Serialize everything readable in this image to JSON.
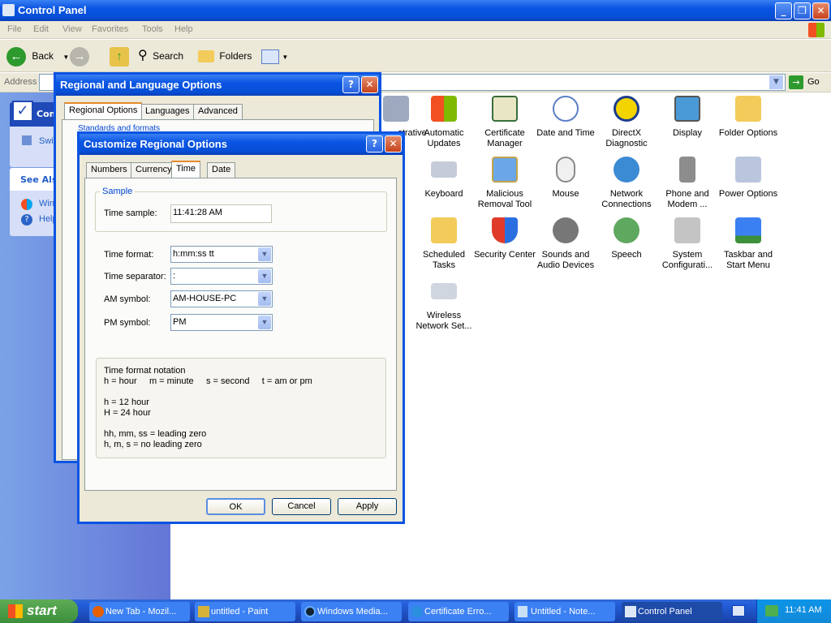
{
  "window": {
    "title": "Control Panel"
  },
  "menu": [
    "File",
    "Edit",
    "View",
    "Favorites",
    "Tools",
    "Help"
  ],
  "toolbar": {
    "back": "Back",
    "search": "Search",
    "folders": "Folders"
  },
  "address": {
    "label": "Address",
    "go": "Go"
  },
  "leftpane": {
    "panel_title": "Con",
    "switch": "Swi",
    "see_also": "See Als",
    "win": "Win",
    "help": "Help"
  },
  "icons": [
    {
      "name": "Administrative Tools",
      "label": "..strative"
    },
    {
      "name": "Automatic Updates",
      "label": "Automatic Updates"
    },
    {
      "name": "Certificate Manager",
      "label": "Certificate Manager"
    },
    {
      "name": "Date and Time",
      "label": "Date and Time"
    },
    {
      "name": "DirectX Diagnostic",
      "label": "DirectX Diagnostic"
    },
    {
      "name": "Display",
      "label": "Display"
    },
    {
      "name": "Folder Options",
      "label": "Folder Options"
    },
    {
      "name": "Keyboard",
      "label": "Keyboard"
    },
    {
      "name": "Malicious Removal Tool",
      "label": "Malicious Removal Tool"
    },
    {
      "name": "Mouse",
      "label": "Mouse"
    },
    {
      "name": "Network Connections",
      "label": "Network Connections"
    },
    {
      "name": "Phone and Modem",
      "label": "Phone and Modem ..."
    },
    {
      "name": "Power Options",
      "label": "Power Options"
    },
    {
      "name": "Scheduled Tasks",
      "label": "Scheduled Tasks"
    },
    {
      "name": "Security Center",
      "label": "Security Center"
    },
    {
      "name": "Sounds and Audio Devices",
      "label": "Sounds and Audio Devices"
    },
    {
      "name": "Speech",
      "label": "Speech"
    },
    {
      "name": "System Configuration",
      "label": "System Configurati..."
    },
    {
      "name": "Taskbar and Start Menu",
      "label": "Taskbar and Start Menu"
    },
    {
      "name": "Wireless Network Setup",
      "label": "Wireless Network Set..."
    }
  ],
  "regional": {
    "title": "Regional and Language Options",
    "tabs": [
      "Regional Options",
      "Languages",
      "Advanced"
    ],
    "group": "Standards and formats"
  },
  "customize": {
    "title": "Customize Regional Options",
    "tabs": [
      "Numbers",
      "Currency",
      "Time",
      "Date"
    ],
    "sample_group": "Sample",
    "time_sample_label": "Time sample:",
    "time_sample_value": "11:41:28 AM",
    "time_format_label": "Time format:",
    "time_format_value": "h:mm:ss tt",
    "separator_label": "Time separator:",
    "separator_value": ":",
    "am_label": "AM symbol:",
    "am_value": "AM-HOUSE-PC",
    "pm_label": "PM symbol:",
    "pm_value": "PM",
    "notation": {
      "title": "Time format notation",
      "line1": "h = hour     m = minute     s = second     t = am or pm",
      "line2": "h = 12 hour",
      "line3": "H = 24 hour",
      "line4": "hh, mm, ss = leading zero",
      "line5": "h, m, s = no leading zero"
    },
    "ok": "OK",
    "cancel": "Cancel",
    "apply": "Apply"
  },
  "taskbar": {
    "start": "start",
    "tasks": [
      "New Tab - Mozil...",
      "untitled - Paint",
      "Windows Media...",
      "Certificate Erro...",
      "Untitled - Note...",
      "Control Panel"
    ],
    "clock": "11:41 AM"
  }
}
